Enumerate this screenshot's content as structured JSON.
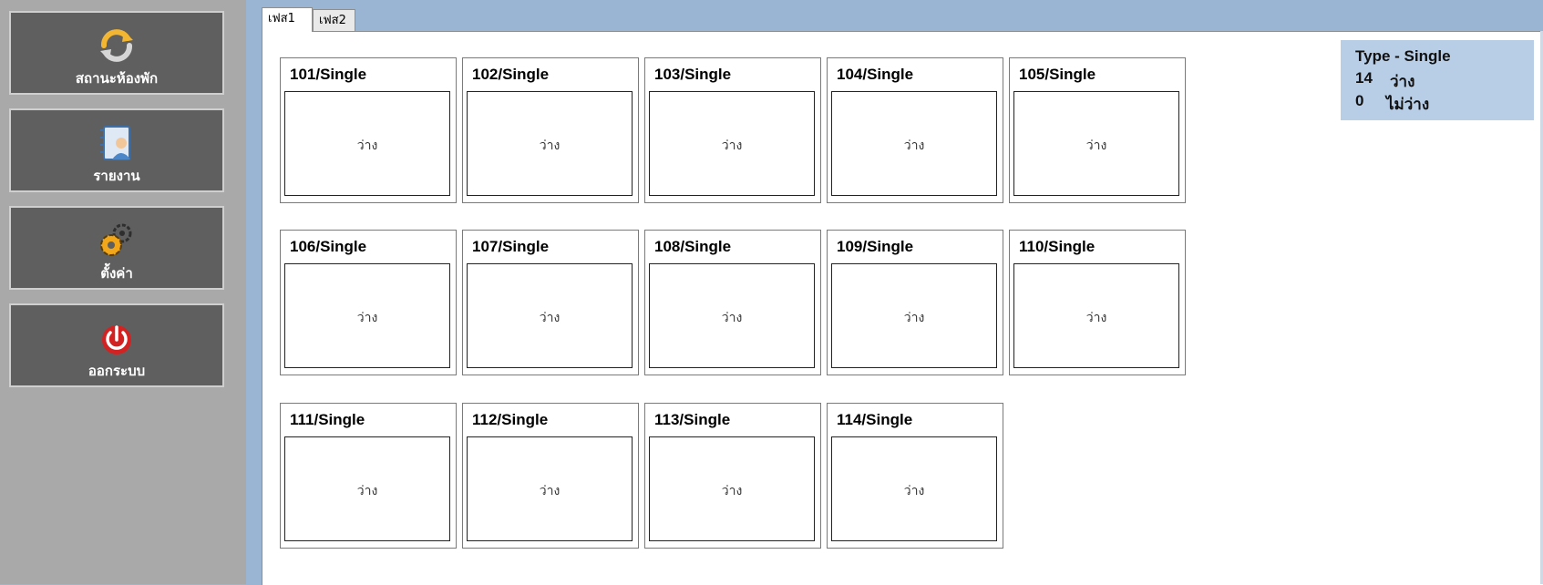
{
  "sidebar": {
    "items": [
      {
        "label": "สถานะห้องพัก",
        "icon": "refresh-icon"
      },
      {
        "label": "รายงาน",
        "icon": "report-book-icon"
      },
      {
        "label": "ตั้งค่า",
        "icon": "gear-icon"
      },
      {
        "label": "ออกระบบ",
        "icon": "power-icon"
      }
    ]
  },
  "tabs": [
    {
      "label": "เฟส1",
      "active": true
    },
    {
      "label": "เฟส2",
      "active": false
    }
  ],
  "rooms": [
    {
      "title": "101/Single",
      "status": "ว่าง"
    },
    {
      "title": "102/Single",
      "status": "ว่าง"
    },
    {
      "title": "103/Single",
      "status": "ว่าง"
    },
    {
      "title": "104/Single",
      "status": "ว่าง"
    },
    {
      "title": "105/Single",
      "status": "ว่าง"
    },
    {
      "title": "106/Single",
      "status": "ว่าง"
    },
    {
      "title": "107/Single",
      "status": "ว่าง"
    },
    {
      "title": "108/Single",
      "status": "ว่าง"
    },
    {
      "title": "109/Single",
      "status": "ว่าง"
    },
    {
      "title": "110/Single",
      "status": "ว่าง"
    },
    {
      "title": "111/Single",
      "status": "ว่าง"
    },
    {
      "title": "112/Single",
      "status": "ว่าง"
    },
    {
      "title": "113/Single",
      "status": "ว่าง"
    },
    {
      "title": "114/Single",
      "status": "ว่าง"
    }
  ],
  "summary": {
    "type_line": "Type - Single",
    "available_count": "14",
    "available_label": "ว่าง",
    "occupied_count": "0",
    "occupied_label": "ไม่ว่าง"
  },
  "colors": {
    "sidebar_bg": "#a9a9a9",
    "button_bg": "#5f5f5f",
    "window_bg": "#9ab4d3",
    "summary_bg": "#b8cde6"
  }
}
